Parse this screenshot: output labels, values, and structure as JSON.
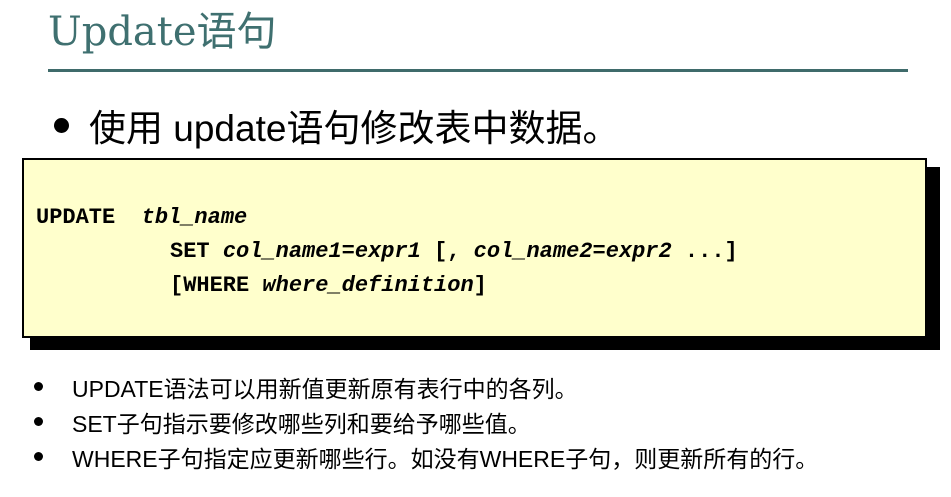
{
  "slide": {
    "title": "Update语句",
    "main_bullet": "使用 update语句修改表中数据。"
  },
  "code": {
    "line1_keyword": "UPDATE",
    "line1_table": "tbl_name",
    "line2_keyword": "SET",
    "line2_col1": "col_name1=expr1",
    "line2_sep": " [, ",
    "line2_col2": "col_name2=expr2",
    "line2_rest": " ...]",
    "line3_open": "[WHERE ",
    "line3_def": "where_definition",
    "line3_close": "]"
  },
  "notes": [
    "UPDATE语法可以用新值更新原有表行中的各列。",
    "SET子句指示要修改哪些列和要给予哪些值。",
    "WHERE子句指定应更新哪些行。如没有WHERE子句，则更新所有的行。"
  ],
  "colors": {
    "title": "#3f7070",
    "rule": "#3f6b6b",
    "code_background": "#ffffcc"
  }
}
